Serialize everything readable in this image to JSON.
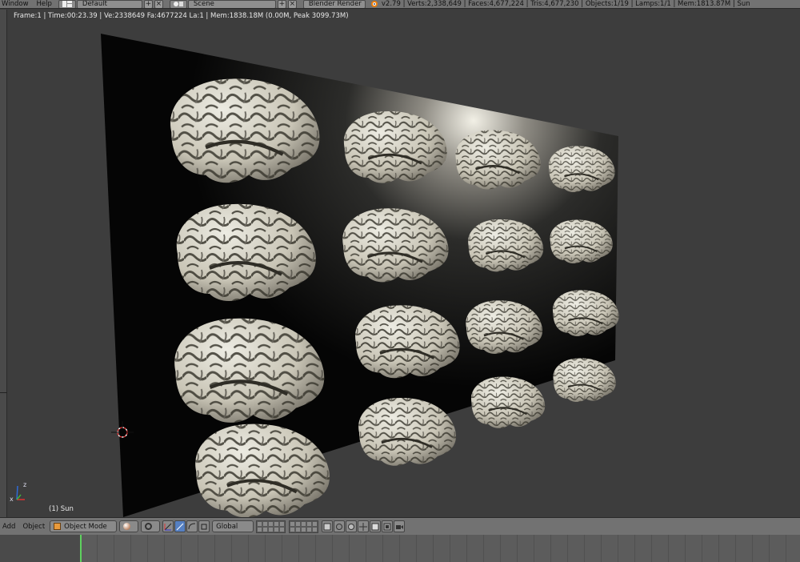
{
  "header": {
    "menus": [
      "Window",
      "Help"
    ],
    "screen_layout": "Default",
    "scene": "Scene",
    "render_engine": "Blender Render",
    "stats": "v2.79 | Verts:2,338,649 | Faces:4,677,224 | Tris:4,677,230 | Objects:1/19 | Lamps:1/1 | Mem:1813.87M | Sun"
  },
  "viewport": {
    "render_info": "Frame:1 | Time:00:23.39 | Ve:2338649 Fa:4677224 La:1 | Mem:1838.18M (0.00M, Peak 3099.73M)",
    "active_object_label": "(1) Sun",
    "axis_labels": {
      "x": "x",
      "z": "z"
    }
  },
  "footer": {
    "menus": [
      "Add",
      "Object"
    ],
    "mode": "Object Mode",
    "orientation": "Global"
  },
  "colors": {
    "ui_header": "#727272",
    "viewport_bg": "#3d3d3d",
    "brain": "#cfcabb",
    "board": "#0c0c0c",
    "active_blue": "#5680c2",
    "frame_marker": "#5ed15e"
  },
  "icons": [
    "layout-icon",
    "scene-icon",
    "plus-icon",
    "close-icon",
    "blender-logo-icon",
    "cube-icon",
    "shading-sphere-icon",
    "pivot-icon",
    "manipulator-icon",
    "translate-icon",
    "rotate-icon",
    "scale-icon",
    "layer-icon",
    "lock-icon",
    "render-icon",
    "snap-icon",
    "magnet-icon",
    "camera-icon"
  ]
}
